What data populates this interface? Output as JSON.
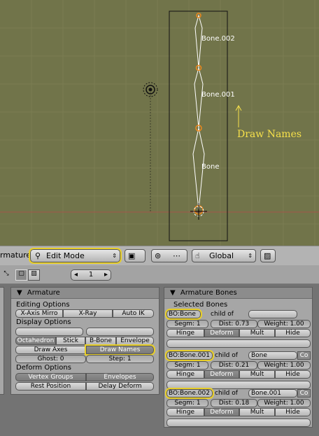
{
  "viewport": {
    "bones": [
      {
        "label": "Bone.002"
      },
      {
        "label": "Bone.001"
      },
      {
        "label": "Bone"
      }
    ],
    "annotation": "Draw Names"
  },
  "header": {
    "left_label": "rmature",
    "mode": "Edit Mode",
    "orientation": "Global"
  },
  "buttons_bar": {
    "frame": "1"
  },
  "armature_panel": {
    "title": "Armature",
    "editing_options": "Editing Options",
    "x_axis_mirror": "X-Axis Mirro",
    "x_ray": "X-Ray",
    "auto_ik": "Auto IK",
    "display_options": "Display Options",
    "octahedron": "Octahedron",
    "stick": "Stick",
    "bbone": "B-Bone",
    "envelope": "Envelope",
    "draw_axes": "Draw Axes",
    "draw_names": "Draw Names",
    "ghost": "Ghost: 0",
    "step": "Step: 1",
    "deform_options": "Deform Options",
    "vertex_groups": "Vertex Groups",
    "envelopes": "Envelopes",
    "rest_position": "Rest Position",
    "delay_deform": "Delay Deform"
  },
  "bones_panel": {
    "title": "Armature Bones",
    "selected_bones": "Selected Bones",
    "child_of": "child of",
    "co": "Co",
    "hinge": "Hinge",
    "deform": "Deform",
    "mult": "Mult",
    "hide": "Hide",
    "entries": [
      {
        "name": "BO:Bone",
        "parent": "",
        "segm": "Segm: 1",
        "dist": "Dist: 0.73",
        "weight": "Weight: 1.00"
      },
      {
        "name": "BO:Bone.001",
        "parent": "Bone",
        "segm": "Segm: 1",
        "dist": "Dist: 0.21",
        "weight": "Weight: 1.00"
      },
      {
        "name": "BO:Bone.002",
        "parent": "Bone.001",
        "segm": "Segm: 1",
        "dist": "Dist: 0.18",
        "weight": "Weight: 1.00"
      }
    ]
  },
  "colors": {
    "viewport_bg": "#71744a",
    "highlight": "#e8cf2a",
    "annotation": "#f6e04a"
  }
}
